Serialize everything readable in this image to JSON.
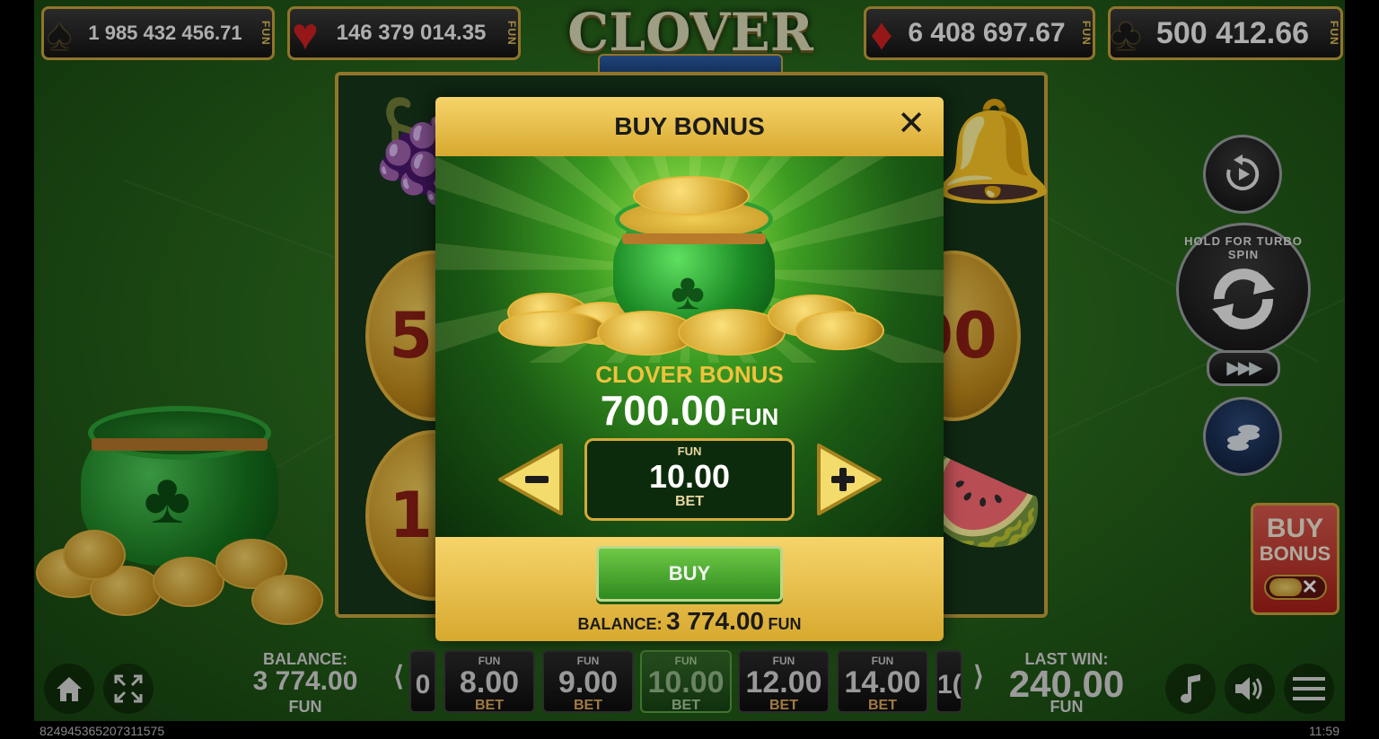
{
  "jackpots": [
    {
      "suit": "spade",
      "glyph": "♠",
      "color": "#1a1a1a",
      "value": "1 985 432 456.71",
      "currency": "FUN"
    },
    {
      "suit": "heart",
      "glyph": "♥",
      "color": "#d02020",
      "value": "146 379 014.35",
      "currency": "FUN"
    },
    {
      "suit": "diamond",
      "glyph": "♦",
      "color": "#d02020",
      "value": "6 408 697.67",
      "currency": "FUN"
    },
    {
      "suit": "club",
      "glyph": "♣",
      "color": "#1a1a1a",
      "value": "500 412.66",
      "currency": "FUN"
    }
  ],
  "logo": {
    "title": "CLOVER"
  },
  "reels": {
    "left_coins": [
      "50",
      "10"
    ],
    "right_coins": [
      "00"
    ]
  },
  "right_controls": {
    "turbo_text": "HOLD FOR TURBO SPIN",
    "fast_forward": "▶▶▶",
    "buy_bonus_line1": "BUY",
    "buy_bonus_line2": "BONUS"
  },
  "modal": {
    "title": "BUY BONUS",
    "close_glyph": "✕",
    "bonus_name": "CLOVER BONUS",
    "price": "700.00",
    "price_currency": "FUN",
    "bet_currency": "FUN",
    "bet_value": "10.00",
    "bet_label": "BET",
    "buy_label": "BUY",
    "balance_label": "BALANCE:",
    "balance_value": "3 774.00",
    "balance_currency": "FUN"
  },
  "bottom": {
    "balance_label": "BALANCE:",
    "balance_value": "3 774.00",
    "balance_currency": "FUN",
    "bet_chips": [
      {
        "currency": "FUN",
        "value": "8.00",
        "label": "BET"
      },
      {
        "currency": "FUN",
        "value": "9.00",
        "label": "BET"
      },
      {
        "currency": "FUN",
        "value": "10.00",
        "label": "BET",
        "selected": true
      },
      {
        "currency": "FUN",
        "value": "12.00",
        "label": "BET"
      },
      {
        "currency": "FUN",
        "value": "14.00",
        "label": "BET"
      }
    ],
    "partial_chip_left": "0",
    "partial_chip_right": "1(",
    "prev_glyph": "⟨",
    "next_glyph": "⟩",
    "last_win_label": "LAST WIN:",
    "last_win_value": "240.00",
    "last_win_currency": "FUN"
  },
  "status": {
    "session_id": "824945365207311575",
    "time": "11:59"
  },
  "colors": {
    "accent_gold": "#d7a92f",
    "felt_green": "#2a6a1d",
    "buy_green": "#4caf34"
  }
}
